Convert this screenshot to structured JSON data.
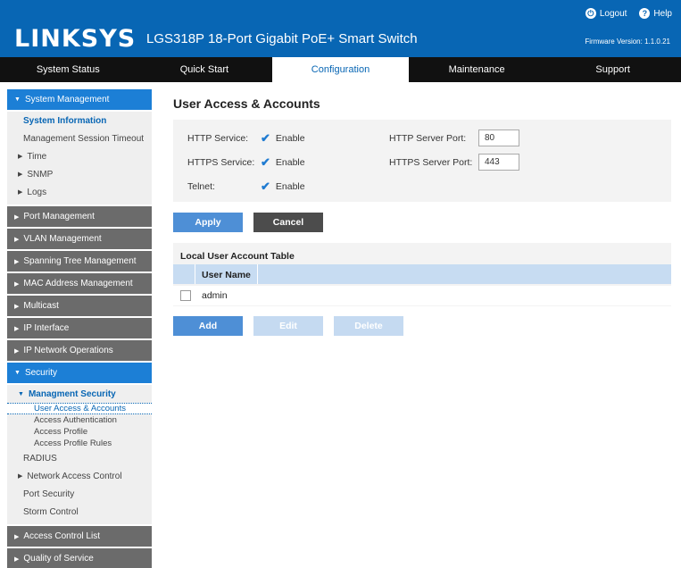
{
  "header": {
    "logo": "LINKSYS",
    "product": "LGS318P 18-Port Gigabit PoE+ Smart Switch",
    "logout": "Logout",
    "help": "Help",
    "firmware": "Firmware Version: 1.1.0.21",
    "bg_color": "#0866b4"
  },
  "nav": [
    "System Status",
    "Quick Start",
    "Configuration",
    "Maintenance",
    "Support"
  ],
  "sidebar": {
    "system_management": "System Management",
    "system_information": "System Information",
    "mgmt_session_timeout": "Management Session Timeout",
    "time": "Time",
    "snmp": "SNMP",
    "logs": "Logs",
    "port_management": "Port Management",
    "vlan_management": "VLAN Management",
    "spanning_tree": "Spanning Tree Management",
    "mac_address": "MAC Address Management",
    "multicast": "Multicast",
    "ip_interface": "IP Interface",
    "ip_network": "IP Network Operations",
    "security": "Security",
    "mgmt_security": "Managment Security",
    "user_access": "User Access & Accounts",
    "access_auth": "Access Authentication",
    "access_profile": "Access Profile",
    "access_profile_rules": "Access Profile Rules",
    "radius": "RADIUS",
    "network_access": "Network Access Control",
    "port_security": "Port Security",
    "storm_control": "Storm Control",
    "acl": "Access Control List",
    "qos": "Quality of Service"
  },
  "main": {
    "title": "User Access & Accounts",
    "http_service": "HTTP Service:",
    "https_service": "HTTPS Service:",
    "telnet": "Telnet:",
    "enable": "Enable",
    "http_port_label": "HTTP Server Port:",
    "https_port_label": "HTTPS Server Port:",
    "http_port": "80",
    "https_port": "443",
    "apply": "Apply",
    "cancel": "Cancel",
    "table_title": "Local User Account Table",
    "col_user": "User Name",
    "row_user": "admin",
    "add": "Add",
    "edit": "Edit",
    "delete": "Delete"
  }
}
